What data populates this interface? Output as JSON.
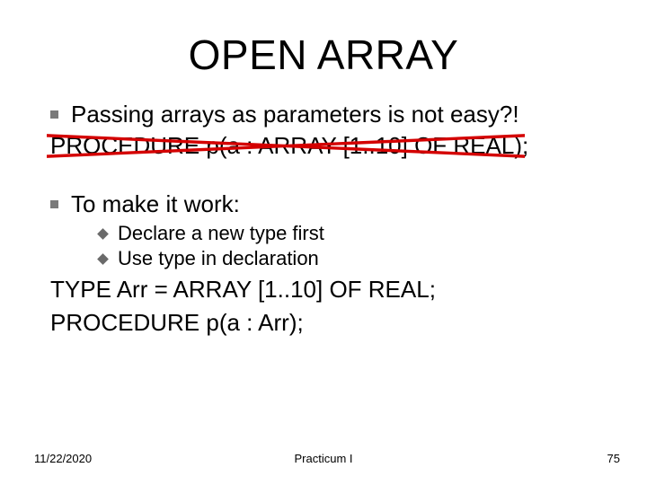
{
  "title": "OPEN ARRAY",
  "bullet1": "Passing arrays as parameters is not easy?!",
  "codeStruck": "PROCEDURE p(a : ARRAY [1..10] OF REAL);",
  "bullet2": "To make it work:",
  "sub1": "Declare a new type first",
  "sub2": "Use type in declaration",
  "code2a": "TYPE Arr = ARRAY [1..10] OF REAL;",
  "code2b": "PROCEDURE p(a : Arr);",
  "footer": {
    "date": "11/22/2020",
    "center": "Practicum I",
    "page": "75"
  }
}
